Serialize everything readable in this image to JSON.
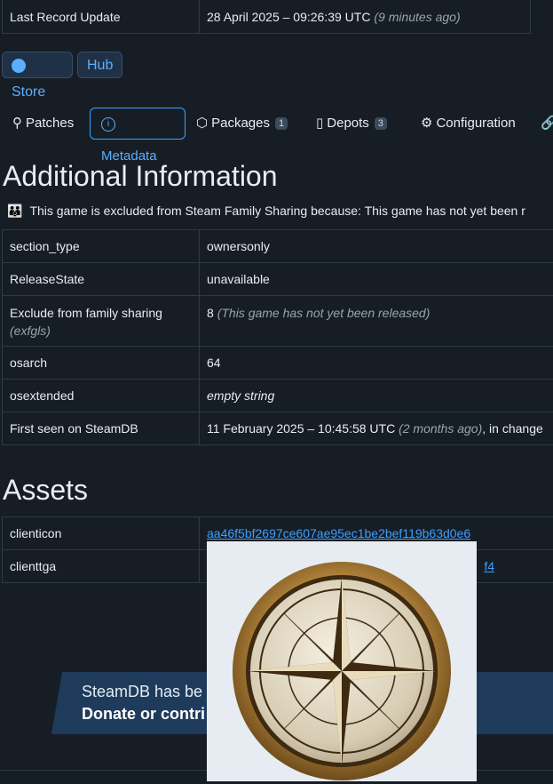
{
  "top_row": {
    "label": "Last Record Update",
    "value": "28 April 2025 – 09:26:39 UTC",
    "note": "(9 minutes ago)"
  },
  "buttons": {
    "store": "Store",
    "hub": "Hub"
  },
  "tabs": [
    {
      "label": "Patches"
    },
    {
      "label": "Metadata"
    },
    {
      "label": "Packages",
      "badge": "1"
    },
    {
      "label": "Depots",
      "badge": "3"
    },
    {
      "label": "Configuration"
    }
  ],
  "additional": {
    "title": "Additional Information",
    "notice": "This game is excluded from Steam Family Sharing because: This game has not yet been r",
    "rows": [
      {
        "k": "section_type",
        "v": "ownersonly"
      },
      {
        "k": "ReleaseState",
        "v": "unavailable"
      },
      {
        "k": "Exclude from family sharing",
        "k2": "(exfgls)",
        "v": "8",
        "v_note": "(This game has not yet been released)"
      },
      {
        "k": "osarch",
        "v": "64"
      },
      {
        "k": "osextended",
        "v_note": "empty string"
      },
      {
        "k": "First seen on SteamDB",
        "v": "11 February 2025 – 10:45:58 UTC",
        "v_note": "(2 months ago)",
        "v_tail": ", in change"
      }
    ]
  },
  "assets": {
    "title": "Assets",
    "rows": [
      {
        "k": "clienticon",
        "v": "aa46f5bf2697ce607ae95ec1be2bef119b63d0e6"
      },
      {
        "k": "clienttga",
        "v": "f4"
      }
    ]
  },
  "banner": {
    "line1": "SteamDB has be",
    "line2": "Donate or contri"
  }
}
